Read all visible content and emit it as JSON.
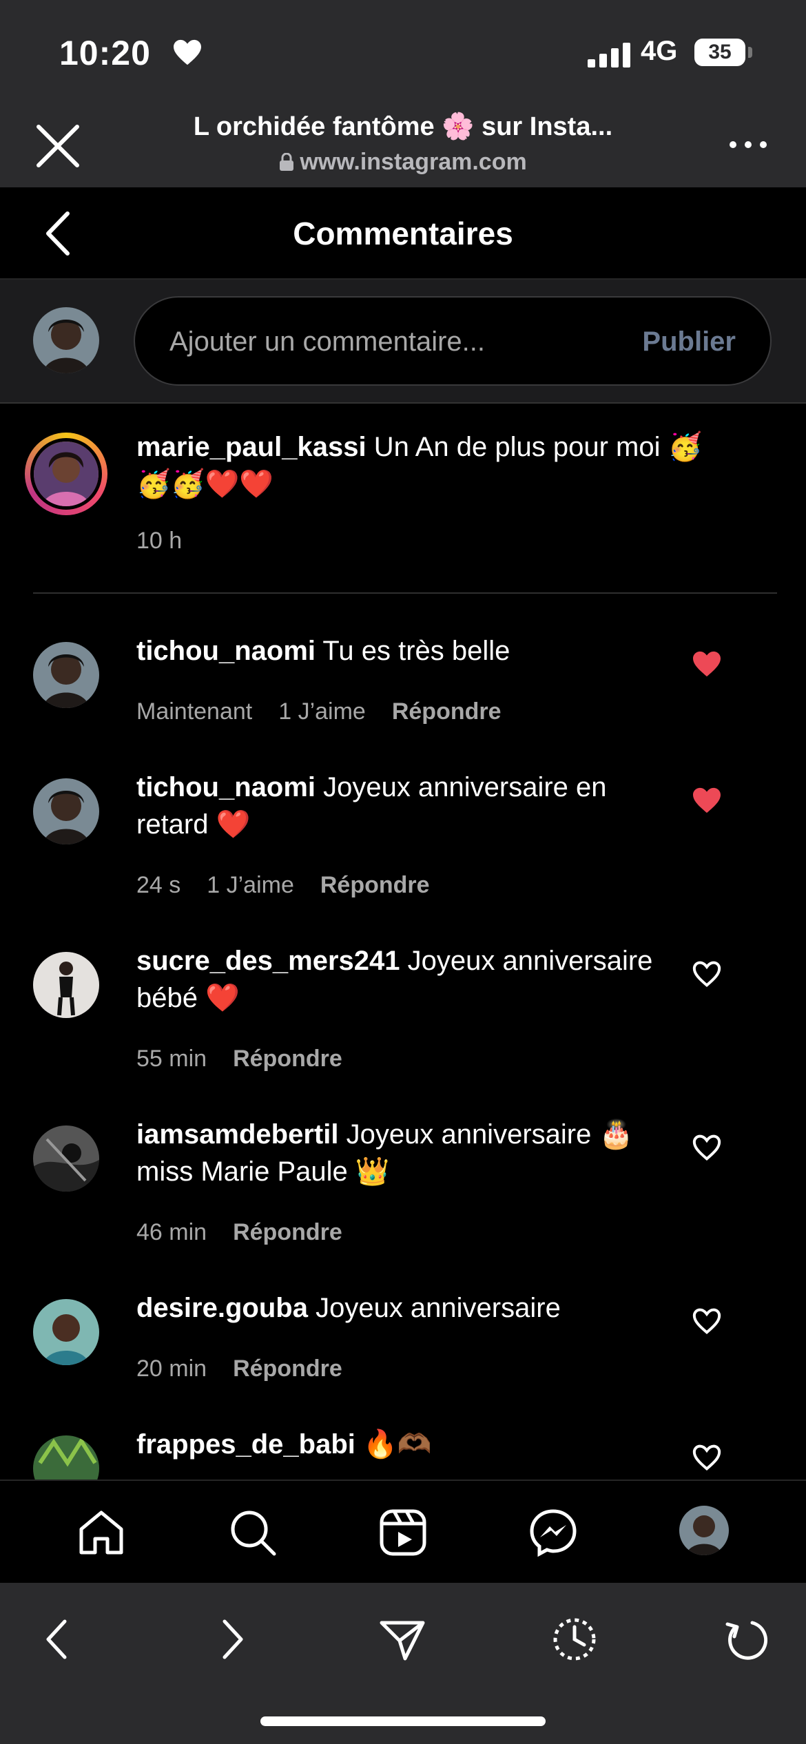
{
  "status": {
    "time": "10:20",
    "network": "4G",
    "battery": "35"
  },
  "browser": {
    "title": "L orchidée fantôme 🌸 sur Insta...",
    "url": "www.instagram.com"
  },
  "header": {
    "title": "Commentaires"
  },
  "add_comment": {
    "placeholder": "Ajouter un commentaire...",
    "publish_label": "Publier"
  },
  "caption": {
    "username": "marie_paul_kassi",
    "text": "Un An de plus pour moi 🥳🥳🥳❤️❤️",
    "time": "10 h"
  },
  "comments": [
    {
      "username": "tichou_naomi",
      "text": "Tu es très belle",
      "time": "Maintenant",
      "likes": "1 J’aime",
      "reply": "Répondre",
      "liked": true
    },
    {
      "username": "tichou_naomi",
      "text": "Joyeux anniversaire en retard ❤️",
      "time": "24 s",
      "likes": "1 J’aime",
      "reply": "Répondre",
      "liked": true
    },
    {
      "username": "sucre_des_mers241",
      "text": "Joyeux anniversaire bébé ❤️",
      "time": "55 min",
      "likes": "",
      "reply": "Répondre",
      "liked": false
    },
    {
      "username": "iamsamdebertil",
      "text": "Joyeux anniversaire 🎂 miss Marie Paule 👑",
      "time": "46 min",
      "likes": "",
      "reply": "Répondre",
      "liked": false
    },
    {
      "username": "desire.gouba",
      "text": "Joyeux anniversaire",
      "time": "20 min",
      "likes": "",
      "reply": "Répondre",
      "liked": false
    },
    {
      "username": "frappes_de_babi",
      "text": "🔥🫶🏾",
      "time": "",
      "likes": "",
      "reply": "",
      "liked": false
    }
  ],
  "nav": [
    "home-icon",
    "search-icon",
    "reels-icon",
    "messenger-icon",
    "profile-avatar"
  ],
  "browser_nav": [
    "back-icon",
    "forward-icon",
    "share-icon",
    "history-icon",
    "reload-icon"
  ],
  "colors": {
    "liked_heart": "#ed4956",
    "status_bg": "#2b2b2d",
    "publish": "#6b7a92"
  }
}
